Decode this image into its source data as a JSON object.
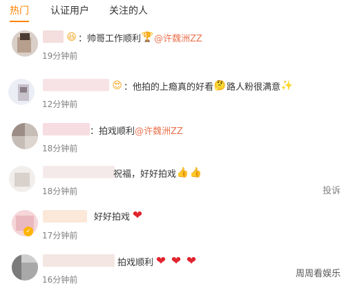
{
  "tabs": [
    {
      "label": "热门",
      "active": true
    },
    {
      "label": "认证用户",
      "active": false
    },
    {
      "label": "关注的人",
      "active": false
    }
  ],
  "comments": [
    {
      "segments": [
        {
          "type": "emoji",
          "icon": "laughing-face-emoji",
          "glyph": "😆"
        },
        {
          "type": "text",
          "value": "：帅哥工作顺利"
        },
        {
          "type": "emoji",
          "icon": "trophy-emoji",
          "glyph": "🏆"
        },
        {
          "type": "mention",
          "value": "@许魏洲ZZ"
        }
      ],
      "time": "19分钟前"
    },
    {
      "segments": [
        {
          "type": "emoji",
          "icon": "heart-eyes-emoji",
          "glyph": "😍"
        },
        {
          "type": "text",
          "value": "：他拍的上瘾真的好看"
        },
        {
          "type": "emoji",
          "icon": "pointing-face-emoji",
          "glyph": "🤔"
        },
        {
          "type": "text",
          "value": "路人粉很满意"
        },
        {
          "type": "emoji",
          "icon": "sparkle-emoji",
          "glyph": "✨"
        }
      ],
      "time": "12分钟前"
    },
    {
      "segments": [
        {
          "type": "text",
          "value": "：拍戏顺利"
        },
        {
          "type": "mention",
          "value": "@许魏洲ZZ"
        }
      ],
      "time": "18分钟前"
    },
    {
      "segments": [
        {
          "type": "text",
          "value": "祝福，好好拍戏"
        },
        {
          "type": "emoji",
          "icon": "thumbs-up-emoji",
          "glyph": "👍"
        },
        {
          "type": "emoji",
          "icon": "thumbs-up-emoji",
          "glyph": "👍"
        }
      ],
      "time": "18分钟前"
    },
    {
      "segments": [
        {
          "type": "text",
          "value": "好好拍戏"
        },
        {
          "type": "emoji",
          "icon": "heart-emoji",
          "glyph": "❤"
        }
      ],
      "time": "17分钟前"
    },
    {
      "segments": [
        {
          "type": "text",
          "value": "拍戏顺利"
        },
        {
          "type": "emoji",
          "icon": "heart-emoji",
          "glyph": "❤"
        },
        {
          "type": "emoji",
          "icon": "heart-emoji",
          "glyph": "❤"
        },
        {
          "type": "emoji",
          "icon": "heart-emoji",
          "glyph": "❤"
        }
      ],
      "time": "16分钟前"
    }
  ],
  "report_label": "投诉",
  "watermark": "周周看娱乐",
  "colors": {
    "accent": "#ff8200",
    "mention": "#eb7350",
    "time": "#808080",
    "heart": "#e0242e"
  }
}
